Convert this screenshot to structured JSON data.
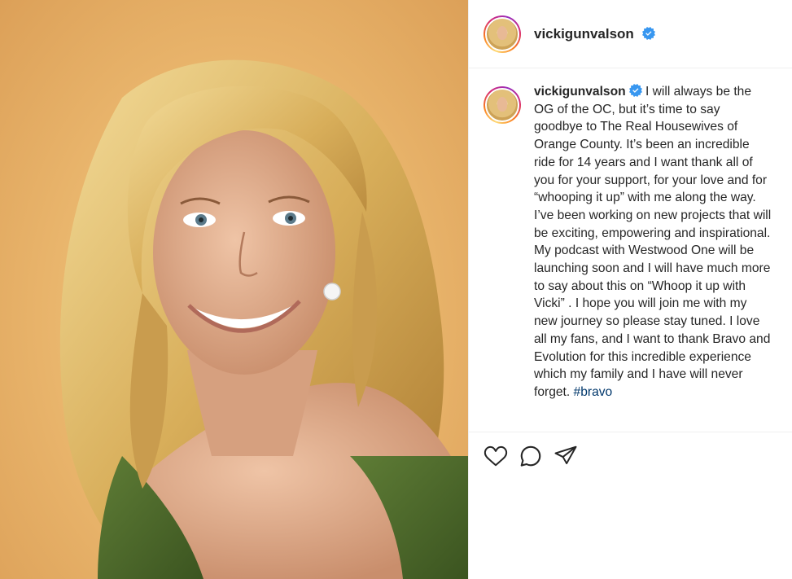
{
  "post": {
    "username": "vickigunvalson",
    "verified": true,
    "caption_username": "vickigunvalson",
    "caption_text": " I will always be the OG of the OC, but it’s time to say goodbye to The Real Housewives of Orange County. It’s been an incredible ride for 14 years and I want thank all of you for your support, for your love and for “whooping it up” with me along the way. I’ve been working on new projects that will be exciting, empowering and inspirational. My podcast with Westwood One will be launching soon and I will have much more to say about this on “Whoop it up with Vicki” . I hope you will join me with my new journey so please stay tuned. I love all my fans, and I want to thank Bravo and Evolution for this incredible experience which my family and I have will never forget. ",
    "hashtag": "#bravo"
  },
  "actions": {
    "like_icon": "heart-icon",
    "comment_icon": "comment-icon",
    "share_icon": "paper-plane-icon"
  },
  "colors": {
    "verified_badge": "#3897f0",
    "hashtag": "#00376b",
    "photo_background": "#e9b56c",
    "dress": "#4d6a2a"
  }
}
